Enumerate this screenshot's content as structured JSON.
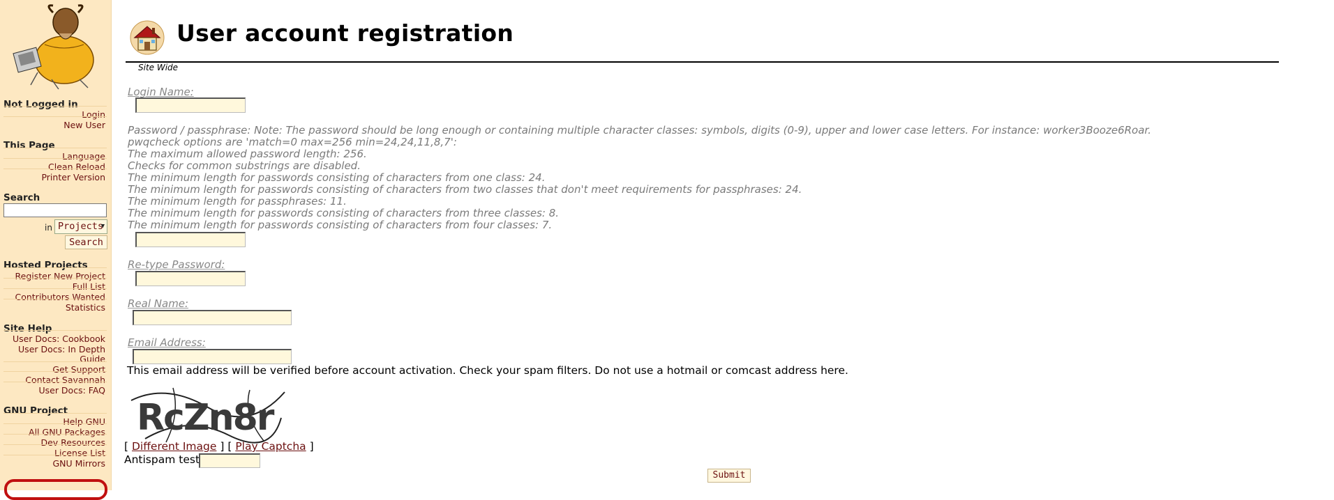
{
  "sidebar": {
    "login_section": {
      "heading": "Not Logged in",
      "links": [
        "Login",
        "New User"
      ]
    },
    "this_page": {
      "heading": "This Page",
      "links": [
        "Language",
        "Clean Reload",
        "Printer Version"
      ]
    },
    "search": {
      "heading": "Search",
      "in_label": "in",
      "scope_value": "Projects",
      "button": "Search"
    },
    "hosted_projects": {
      "heading": "Hosted Projects",
      "links": [
        "Register New Project",
        "Full List",
        "Contributors Wanted",
        "Statistics"
      ]
    },
    "site_help": {
      "heading": "Site Help",
      "links": [
        "User Docs: Cookbook",
        "User Docs: In Depth",
        "Guide",
        "Get Support",
        "Contact Savannah",
        "User Docs: FAQ"
      ]
    },
    "gnu_project": {
      "heading": "GNU Project",
      "links": [
        "Help GNU",
        "All GNU Packages",
        "Dev Resources",
        "License List",
        "GNU Mirrors"
      ]
    }
  },
  "page": {
    "icon": "house-icon",
    "title": "User account registration",
    "subtitle": "Site Wide"
  },
  "form": {
    "login_label": "Login Name:",
    "password_notes": [
      "Password / passphrase: Note: The password should be long enough or containing multiple character classes: symbols, digits (0-9), upper and lower case letters. For instance: worker3Booze6Roar.",
      "pwqcheck options are 'match=0 max=256 min=24,24,11,8,7':",
      "The maximum allowed password length: 256.",
      "Checks for common substrings are disabled.",
      "The minimum length for passwords consisting of characters from one class: 24.",
      "The minimum length for passwords consisting of characters from two classes that don't meet requirements for passphrases: 24.",
      "The minimum length for passphrases: 11.",
      "The minimum length for passwords consisting of characters from three classes: 8.",
      "The minimum length for passwords consisting of characters from four classes: 7."
    ],
    "retype_label": "Re-type Password:",
    "realname_label": "Real Name:",
    "email_label": "Email Address:",
    "email_note": "This email address will be verified before account activation. Check your spam filters. Do not use a hotmail or comcast address here.",
    "captcha_text": "RcZn8r",
    "captcha_links": {
      "open": "[",
      "different": "Different Image",
      "mid": "] [",
      "play": "Play Captcha",
      "close": "]"
    },
    "antispam_label": "Antispam test:",
    "submit": "Submit"
  },
  "colors": {
    "sidebar_bg": "#fde8c2",
    "link": "#6b1010",
    "input_bg": "#fff8dc"
  }
}
